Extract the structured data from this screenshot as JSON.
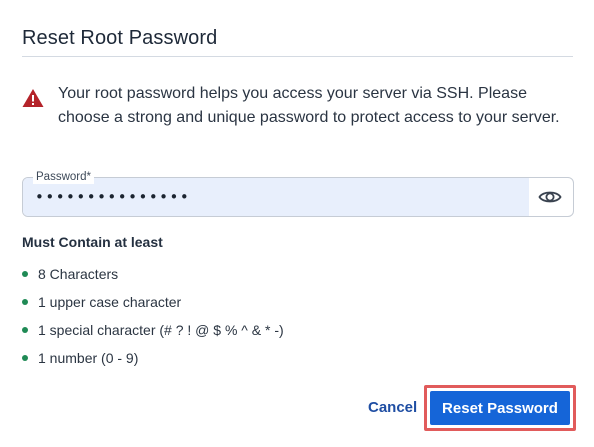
{
  "dialog": {
    "title": "Reset Root Password"
  },
  "warning": {
    "icon": "warning-triangle-icon",
    "icon_color": "#b4232a",
    "text": "Your root password helps you access your server via SSH. Please choose a strong and unique password to protect access to your server."
  },
  "password_field": {
    "label": "Password",
    "required_marker": "*",
    "value": "•••••••••••••••",
    "toggle_icon": "eye-icon"
  },
  "requirements": {
    "title": "Must Contain at least",
    "items": [
      "8 Characters",
      "1 upper case character",
      "1 special character (# ? ! @ $ % ^ & * -)",
      "1 number (0 - 9)"
    ],
    "bullet_color": "#1f8a55"
  },
  "actions": {
    "cancel_label": "Cancel",
    "reset_label": "Reset Password",
    "primary_color": "#1565d8",
    "highlight_color": "#e15b5b"
  }
}
